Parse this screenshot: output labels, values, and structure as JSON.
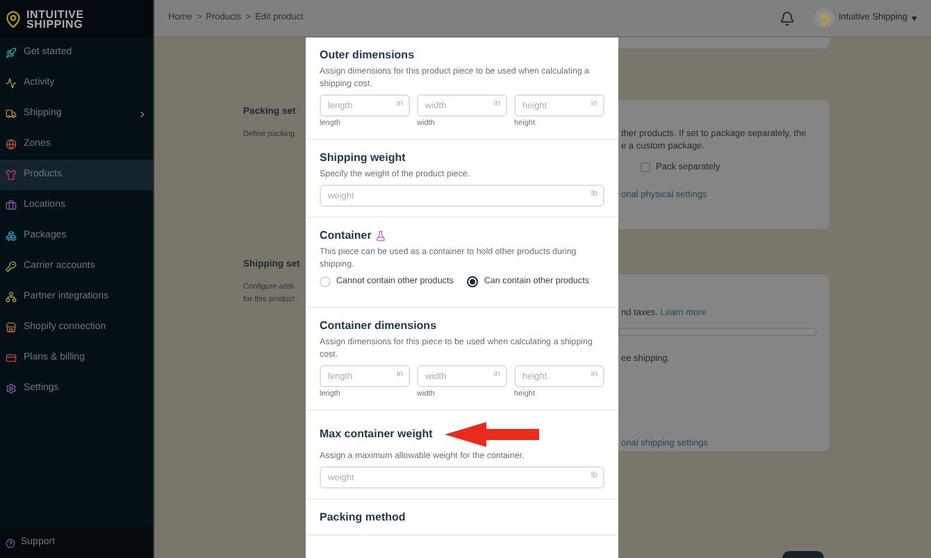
{
  "sidebar": {
    "logo": [
      "INTUITIVE",
      "SHIPPING"
    ],
    "items": [
      {
        "label": "Get started",
        "selected": false,
        "submenu": false
      },
      {
        "label": "Activity",
        "selected": false,
        "submenu": false
      },
      {
        "label": "Shipping",
        "selected": false,
        "submenu": true
      },
      {
        "label": "Zones",
        "selected": false,
        "submenu": false
      },
      {
        "label": "Products",
        "selected": true,
        "submenu": false
      },
      {
        "label": "Locations",
        "selected": false,
        "submenu": false
      },
      {
        "label": "Packages",
        "selected": false,
        "submenu": false
      },
      {
        "label": "Carrier accounts",
        "selected": false,
        "submenu": false
      },
      {
        "label": "Partner integrations",
        "selected": false,
        "submenu": false
      },
      {
        "label": "Shopify connection",
        "selected": false,
        "submenu": false
      },
      {
        "label": "Plans & billing",
        "selected": false,
        "submenu": false
      },
      {
        "label": "Settings",
        "selected": false,
        "submenu": false
      }
    ],
    "footer": "Support"
  },
  "header": {
    "breadcrumb": [
      "Home",
      "Products",
      "Edit product"
    ],
    "separator": ">",
    "account": "Intuitive Shipping"
  },
  "background": {
    "sections": [
      {
        "title": "Packing set",
        "description": [
          "Define packing"
        ]
      },
      {
        "title": "Shipping set",
        "description": [
          "Configure addi",
          "for this product"
        ]
      }
    ],
    "packing_card": {
      "lines": [
        "ther products. If set to package separately, the",
        "e a custom package."
      ],
      "checkbox": {
        "label": "Pack separately",
        "checked": false
      },
      "link": "onal physical settings"
    },
    "shipping_card": {
      "text": "nd taxes.",
      "link_inline": "Learn more",
      "note": "ee shipping.",
      "link": "onal shipping settings"
    }
  },
  "modal": {
    "sections": [
      {
        "kind": "dimensions",
        "title": "Outer dimensions",
        "description": "Assign dimensions for this product piece to be used when calculating a shipping cost.",
        "fields": [
          {
            "placeholder": "length",
            "unit": "in",
            "label": "length"
          },
          {
            "placeholder": "width",
            "unit": "in",
            "label": "width"
          },
          {
            "placeholder": "height",
            "unit": "in",
            "label": "height"
          }
        ]
      },
      {
        "kind": "weight",
        "title": "Shipping weight",
        "description": "Specify the weight of the product piece.",
        "field": {
          "placeholder": "weight",
          "unit": "lb"
        },
        "arrow": false
      },
      {
        "kind": "radios",
        "title": "Container",
        "description": "This piece can be used as a container to hold other products during shipping.",
        "options": [
          {
            "label": "Cannot contain other products",
            "selected": false
          },
          {
            "label": "Can contain other products",
            "selected": true
          }
        ]
      },
      {
        "kind": "dimensions",
        "title": "Container dimensions",
        "description": "Assign dimensions for this piece to be used when calculating a shipping cost.",
        "fields": [
          {
            "placeholder": "length",
            "unit": "in",
            "label": "length"
          },
          {
            "placeholder": "width",
            "unit": "in",
            "label": "width"
          },
          {
            "placeholder": "height",
            "unit": "in",
            "label": "height"
          }
        ]
      },
      {
        "kind": "weight",
        "title": "Max container weight",
        "description": "Assign a maximum allowable weight for the container.",
        "field": {
          "placeholder": "weight",
          "unit": "lb"
        },
        "arrow": true
      },
      {
        "kind": "heading",
        "title": "Packing method"
      }
    ]
  }
}
